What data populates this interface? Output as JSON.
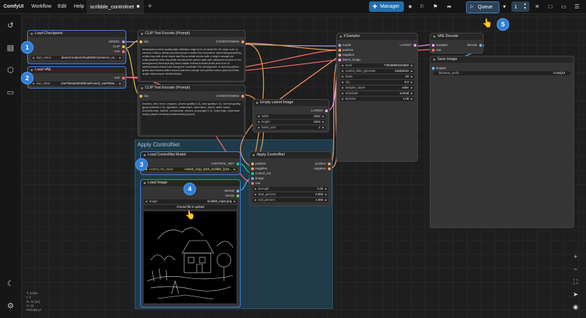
{
  "app": {
    "brand": "ComfyUI"
  },
  "menu": {
    "workflow": "Workflow",
    "edit": "Edit",
    "help": "Help"
  },
  "tab": {
    "name": "scribble_controlnet",
    "new_icon": "+"
  },
  "toolbar": {
    "manager": "Manager",
    "queue": "Queue",
    "queue_count": "1"
  },
  "group": {
    "title": "Apply ControlNet"
  },
  "nodes": {
    "load_checkpoint": {
      "title": "Load Checkpoint",
      "outputs": [
        "MODEL",
        "CLIP",
        "VAE"
      ],
      "widget_label": "ckpt_name",
      "widget_value": "dreamCreationVirtual3DECommerce_v1..."
    },
    "load_vae": {
      "title": "Load VAE",
      "outputs": [
        "VAE"
      ],
      "widget_label": "vae_name",
      "widget_value": "vaeFtMse840000EmaPruned_vaeFtMse..."
    },
    "clip_pos": {
      "title": "CLIP Text Encode (Prompt)",
      "input": "clip",
      "output": "CONDITIONING",
      "text": "Masterpiece,best quality,high definition,high level of detail,3D,3D style,cute Q-version,Chibi,a vibrant product photo created for innovative advertising,featuring a little boy with short black hair,Snow-white shorts with a bright orange pie crate,pasture,blue sky,white clouds,brick paved path,with pleasant houses in the background,chimneys,big trees,maple leaves,bushes,trees,and a lot of wheat,wheat,wheat ears along the roadside,The atmosphere of autumn,yellow grass and leaves,fallen leaves,barriers,orange and yellow colors,autumn,Wide-angle views,super details,bright"
    },
    "clip_neg": {
      "title": "CLIP Text Encode (Prompt)",
      "input": "clip",
      "output": "CONDITIONING",
      "text": "(hands), text, error, cropped, (worst quality:1.2), (low quality:1.2), normal quality, (jpeg artifacts:1.3), signature, watermark, username, blurry, artist name, monochrome, sketch, censorship, censor, (copyright:1.2), extra legs, (forehead mark) (depth of field) (emotionless) (penis)"
    },
    "ksampler": {
      "title": "KSampler",
      "inputs": [
        "model",
        "positive",
        "negative",
        "latent_image"
      ],
      "output": "LATENT",
      "widgets": [
        {
          "label": "seed",
          "value": "776030803154660"
        },
        {
          "label": "control_after_generate",
          "value": "randomize"
        },
        {
          "label": "steps",
          "value": "20"
        },
        {
          "label": "cfg",
          "value": "8.0"
        },
        {
          "label": "sampler_name",
          "value": "euler"
        },
        {
          "label": "scheduler",
          "value": "normal"
        },
        {
          "label": "denoise",
          "value": "1.00"
        }
      ]
    },
    "vae_decode": {
      "title": "VAE Decode",
      "inputs": [
        "samples",
        "vae"
      ],
      "output": "IMAGE"
    },
    "save_image": {
      "title": "Save Image",
      "input": "images",
      "widget_label": "filename_prefix",
      "widget_value": "ComfyUI"
    },
    "empty_latent": {
      "title": "Empty Latent Image",
      "output": "LATENT",
      "widgets": [
        {
          "label": "width",
          "value": "1024"
        },
        {
          "label": "height",
          "value": "1024"
        },
        {
          "label": "batch_size",
          "value": "1"
        }
      ]
    },
    "load_controlnet": {
      "title": "Load ControlNet Model",
      "output": "CONTROL_NET",
      "widget_label": "control_net_name",
      "widget_value": "control_v11p_sd15_scribble_fp16..."
    },
    "load_image": {
      "title": "Load Image",
      "outputs": [
        "IMAGE",
        "MASK"
      ],
      "widget_label": "image",
      "widget_value": "scribble_input.png",
      "upload_label": "choose file to upload"
    },
    "apply_controlnet": {
      "title": "Apply ControlNet",
      "inputs": [
        "positive",
        "negative",
        "control_net",
        "image",
        "vae"
      ],
      "outputs": [
        "positive",
        "negative"
      ],
      "widgets": [
        {
          "label": "strength",
          "value": "1.00"
        },
        {
          "label": "start_percent",
          "value": "0.000"
        },
        {
          "label": "end_percent",
          "value": "1.000"
        }
      ]
    }
  },
  "badges": [
    "1",
    "2",
    "3",
    "4",
    "5"
  ],
  "stats": [
    "T: 0.00s",
    "I: 0",
    "N: 11 [11]",
    "V: 23",
    "FPS:59.17"
  ],
  "colors": {
    "accent": "#3d86e0",
    "clip_wire": "#f5c542",
    "model_wire": "#b39ddb",
    "conditioning_wire": "#ff9e6e",
    "vae_wire": "#ff6e6e",
    "latent_wire": "#ff9cf9",
    "image_wire": "#64b5f6",
    "controlnet_wire": "#00d78d"
  }
}
